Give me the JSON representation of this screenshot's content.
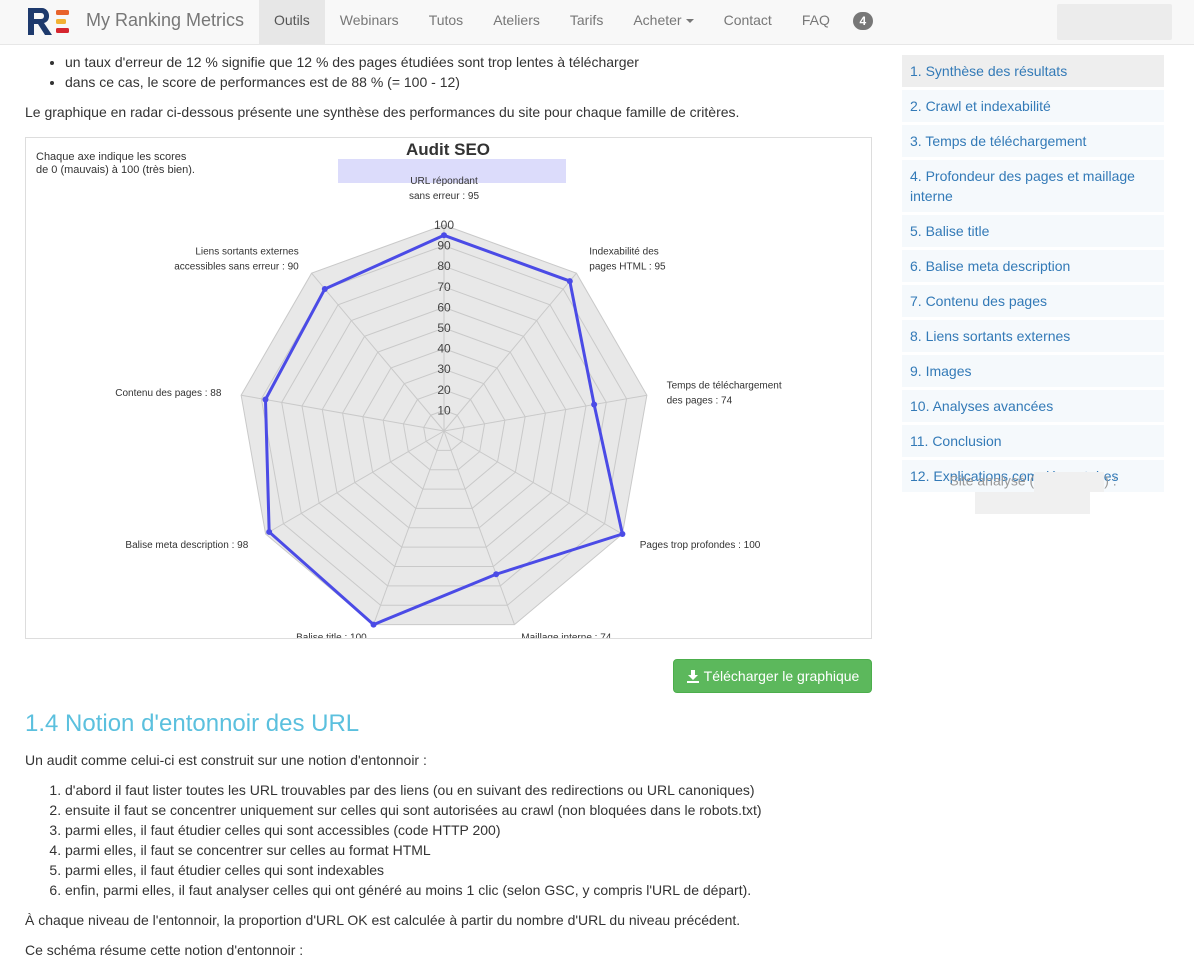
{
  "brand": {
    "name": "My Ranking Metrics"
  },
  "nav": {
    "items": [
      {
        "label": "Outils",
        "active": true
      },
      {
        "label": "Webinars"
      },
      {
        "label": "Tutos"
      },
      {
        "label": "Ateliers"
      },
      {
        "label": "Tarifs"
      },
      {
        "label": "Acheter"
      },
      {
        "label": "Contact"
      },
      {
        "label": "FAQ"
      }
    ],
    "badge": "4"
  },
  "content": {
    "bullets": [
      "un taux d'erreur de 12 % signifie que 12 % des pages étudiées sont trop lentes à télécharger",
      "dans ce cas, le score de performances est de 88 % (= 100 - 12)"
    ],
    "intro": "Le graphique en radar ci-dessous présente une synthèse des performances du site pour chaque famille de critères.",
    "download_label": "Télécharger le graphique",
    "section_title": "1.4 Notion d'entonnoir des URL",
    "funnel_intro": "Un audit comme celui-ci est construit sur une notion d'entonnoir :",
    "steps": [
      "d'abord il faut lister toutes les URL trouvables par des liens (ou en suivant des redirections ou URL canoniques)",
      "ensuite il faut se concentrer uniquement sur celles qui sont autorisées au crawl (non bloquées dans le robots.txt)",
      "parmi elles, il faut étudier celles qui sont accessibles (code HTTP 200)",
      "parmi elles, il faut se concentrer sur celles au format HTML",
      "parmi elles, il faut étudier celles qui sont indexables",
      "enfin, parmi elles, il faut analyser celles qui ont généré au moins 1 clic (selon GSC, y compris l'URL de départ)."
    ],
    "funnel_note": "À chaque niveau de l'entonnoir, la proportion d'URL OK est calculée à partir du nombre d'URL du niveau précédent.",
    "schema_intro": "Ce schéma résume cette notion d'entonnoir :"
  },
  "sidebar": {
    "toc": [
      "1. Synthèse des résultats",
      "2. Crawl et indexabilité",
      "3. Temps de téléchargement",
      "4. Profondeur des pages et maillage interne",
      "5. Balise title",
      "6. Balise meta description",
      "7. Contenu des pages",
      "8. Liens sortants externes",
      "9. Images",
      "10. Analyses avancées",
      "11. Conclusion",
      "12. Explications complémentaires"
    ],
    "site_prefix": "Site analysé (",
    "site_suffix": ") :"
  },
  "colors": {
    "series": "#4b4be6",
    "fill": "#e8e8e8",
    "accent": "#5bc0de",
    "button": "#5cb85c",
    "link": "#337ab7"
  },
  "chart_data": {
    "type": "radar",
    "title": "Audit SEO",
    "note_lines": [
      "Chaque axe indique les scores",
      "de 0 (mauvais) à 100 (très bien)."
    ],
    "rlim": [
      0,
      100
    ],
    "ticks": [
      10,
      20,
      30,
      40,
      50,
      60,
      70,
      80,
      90,
      100
    ],
    "axes": [
      {
        "label_lines": [
          "URL répondant",
          "sans erreur : 95"
        ],
        "value": 95
      },
      {
        "label_lines": [
          "Indexabilité des",
          "pages HTML : 95"
        ],
        "value": 95
      },
      {
        "label_lines": [
          "Temps de téléchargement",
          "des pages : 74"
        ],
        "value": 74
      },
      {
        "label_lines": [
          "Pages trop profondes : 100"
        ],
        "value": 100
      },
      {
        "label_lines": [
          "Maillage interne : 74"
        ],
        "value": 74
      },
      {
        "label_lines": [
          "Balise title : 100"
        ],
        "value": 100
      },
      {
        "label_lines": [
          "Balise meta description : 98"
        ],
        "value": 98
      },
      {
        "label_lines": [
          "Contenu des pages : 88"
        ],
        "value": 88
      },
      {
        "label_lines": [
          "Liens sortants externes",
          "accessibles sans erreur : 90"
        ],
        "value": 90
      }
    ]
  }
}
